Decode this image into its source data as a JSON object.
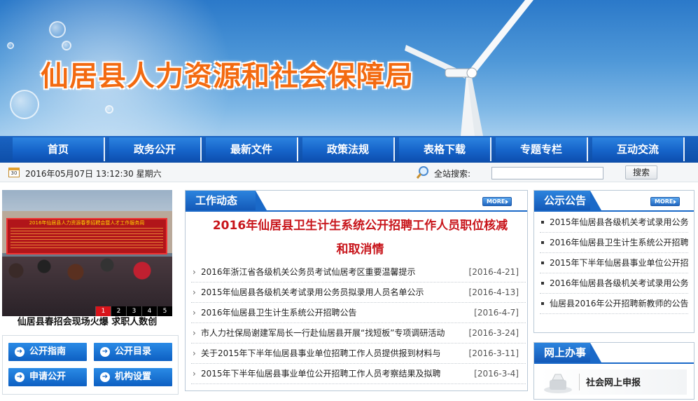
{
  "banner": {
    "title": "仙居县人力资源和社会保障局"
  },
  "nav": {
    "items": [
      "首页",
      "政务公开",
      "最新文件",
      "政策法规",
      "表格下载",
      "专题专栏",
      "互动交流"
    ]
  },
  "datebar": {
    "calendar_day": "30",
    "datetime": "2016年05月07日 13:12:30 星期六",
    "search_label": "全站搜索:",
    "search_value": "",
    "search_button": "搜索"
  },
  "photo": {
    "board_text": "2016年仙居县人力资源春季招聘会暨人才工作服务周",
    "caption": "仙居县春招会现场火爆 求职人数创",
    "pages": [
      "1",
      "2",
      "3",
      "4",
      "5"
    ],
    "active_page": 1
  },
  "quick_links": [
    {
      "label": "公开指南"
    },
    {
      "label": "公开目录"
    },
    {
      "label": "申请公开"
    },
    {
      "label": "机构设置"
    }
  ],
  "work": {
    "tab": "工作动态",
    "more": "MORE",
    "headline_line1": "2016年仙居县卫生计生系统公开招聘工作人员职位核减",
    "headline_line2": "和取消情",
    "items": [
      {
        "title": "2016年浙江省各级机关公务员考试仙居考区重要温馨提示",
        "date": "[2016-4-21]"
      },
      {
        "title": "2015年仙居县各级机关考试录用公务员拟录用人员名单公示",
        "date": "[2016-4-13]"
      },
      {
        "title": "2016年仙居县卫生计生系统公开招聘公告",
        "date": "[2016-4-7]"
      },
      {
        "title": "市人力社保局谢建军局长一行赴仙居县开展“找短板”专项调研活动",
        "date": "[2016-3-24]"
      },
      {
        "title": "关于2015年下半年仙居县事业单位招聘工作人员提供报到材料与",
        "date": "[2016-3-11]"
      },
      {
        "title": "2015年下半年仙居县事业单位公开招聘工作人员考察结果及拟聘",
        "date": "[2016-3-4]"
      }
    ]
  },
  "notice": {
    "tab": "公示公告",
    "more": "MORE",
    "items": [
      "2015年仙居县各级机关考试录用公务",
      "2016年仙居县卫生计生系统公开招聘",
      "2015年下半年仙居县事业单位公开招",
      "2016年仙居县各级机关考试录用公务",
      "仙居县2016年公开招聘新教师的公告"
    ]
  },
  "online": {
    "tab": "网上办事",
    "service": "社会网上申报"
  },
  "colors": {
    "nav_blue": "#1664c9",
    "title_orange": "#f36a10",
    "headline_red": "#c8151b"
  }
}
